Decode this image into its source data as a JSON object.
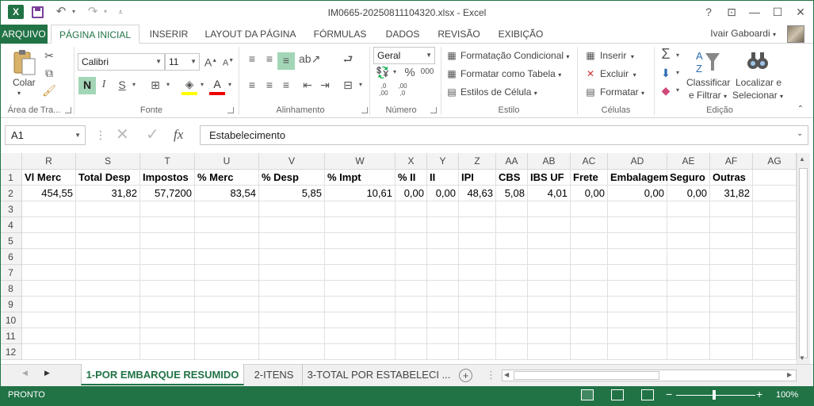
{
  "window": {
    "title": "IM0665-20250811104320.xlsx - Excel",
    "app_icon": "X",
    "help": "?",
    "restore_ribbon": "⊡",
    "minimize": "—",
    "maximize": "☐",
    "close": "✕"
  },
  "ribbon_tabs": {
    "file": "ARQUIVO",
    "items": [
      "PÁGINA INICIAL",
      "INSERIR",
      "LAYOUT DA PÁGINA",
      "FÓRMULAS",
      "DADOS",
      "REVISÃO",
      "EXIBIÇÃO"
    ],
    "active": "PÁGINA INICIAL",
    "user": "Ivair Gaboardi"
  },
  "ribbon": {
    "clipboard": {
      "label": "Área de Tra...",
      "paste": "Colar"
    },
    "font": {
      "label": "Fonte",
      "name": "Calibri",
      "size": "11",
      "bold": "N",
      "italic": "I",
      "underline": "S"
    },
    "alignment": {
      "label": "Alinhamento"
    },
    "number": {
      "label": "Número",
      "format": "Geral",
      "percent": "%",
      "thousands": "000",
      "inc_dec": ",0\n,00",
      "dec_dec": ",00\n,0"
    },
    "styles": {
      "label": "Estilo",
      "conditional": "Formatação Condicional",
      "as_table": "Formatar como Tabela",
      "cell_styles": "Estilos de Célula"
    },
    "cells": {
      "label": "Células",
      "insert": "Inserir",
      "delete": "Excluir",
      "format": "Formatar"
    },
    "editing": {
      "label": "Edição",
      "sort_1": "Classificar",
      "sort_2": "e Filtrar",
      "find_1": "Localizar e",
      "find_2": "Selecionar"
    }
  },
  "formula_bar": {
    "name_box": "A1",
    "fx": "fx",
    "value": "Estabelecimento"
  },
  "sheet": {
    "columns": [
      "R",
      "S",
      "T",
      "U",
      "V",
      "W",
      "X",
      "Y",
      "Z",
      "AA",
      "AB",
      "AC",
      "AD",
      "AE",
      "AF",
      "AG"
    ],
    "row_numbers": [
      "1",
      "2",
      "3",
      "4",
      "5",
      "6",
      "7",
      "8",
      "9",
      "10",
      "11",
      "12"
    ],
    "header_row": [
      "Vl Merc",
      "Total Desp",
      "Impostos",
      "% Merc",
      "% Desp",
      "% Impt",
      "% II",
      "II",
      "IPI",
      "CBS",
      "IBS UF",
      "Frete",
      "Embalagem",
      "Seguro",
      "Outras",
      ""
    ],
    "data_row": [
      "454,55",
      "31,82",
      "57,7200",
      "83,54",
      "5,85",
      "10,61",
      "0,00",
      "0,00",
      "48,63",
      "5,08",
      "4,01",
      "0,00",
      "0,00",
      "0,00",
      "31,82",
      ""
    ]
  },
  "sheet_tabs": {
    "items": [
      "1-POR EMBARQUE RESUMIDO",
      "2-ITENS",
      "3-TOTAL POR ESTABELECI ..."
    ],
    "active": "1-POR EMBARQUE RESUMIDO",
    "add": "+"
  },
  "status": {
    "ready": "PRONTO",
    "zoom_minus": "−",
    "zoom_plus": "+",
    "zoom": "100%"
  }
}
